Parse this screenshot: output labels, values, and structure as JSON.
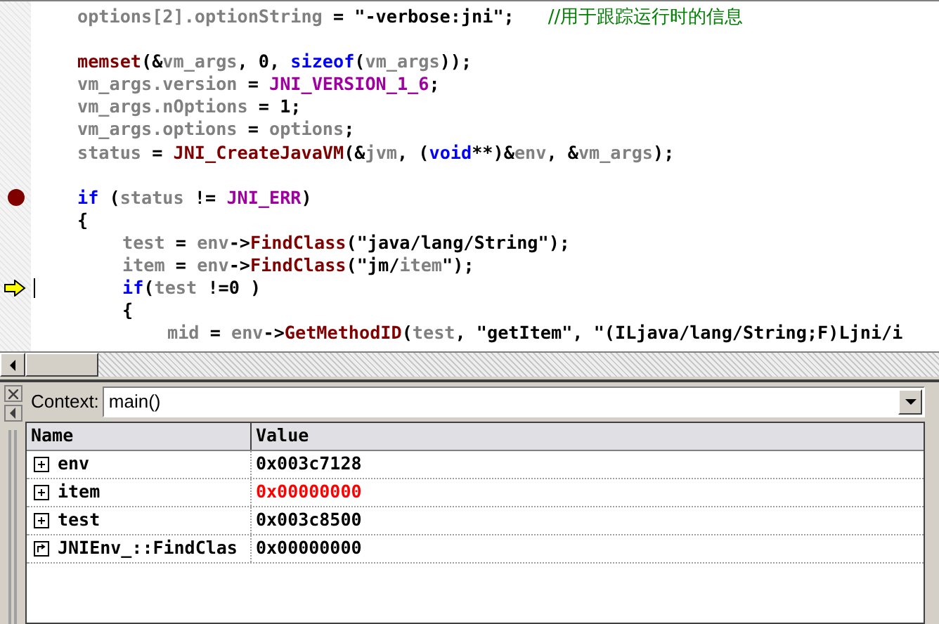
{
  "editor": {
    "lines": [
      {
        "kind": "code",
        "breakpoint": false,
        "current": false,
        "tokens": [
          {
            "kind": "ident",
            "text": "options[2].optionString"
          },
          {
            "kind": "plain",
            "text": " = "
          },
          {
            "kind": "plain",
            "text": "\"-verbose:jni\";"
          },
          {
            "kind": "comment",
            "text": "//用于跟踪运行时的信息"
          }
        ]
      },
      {
        "kind": "blank",
        "breakpoint": false,
        "current": false
      },
      {
        "kind": "code",
        "breakpoint": false,
        "current": false,
        "tokens": [
          {
            "kind": "func",
            "text": "memset"
          },
          {
            "kind": "plain",
            "text": "(&"
          },
          {
            "kind": "ident",
            "text": "vm_args"
          },
          {
            "kind": "plain",
            "text": ", 0, "
          },
          {
            "kind": "keyword",
            "text": "sizeof"
          },
          {
            "kind": "plain",
            "text": "("
          },
          {
            "kind": "ident",
            "text": "vm_args"
          },
          {
            "kind": "plain",
            "text": "));"
          }
        ]
      },
      {
        "kind": "code",
        "breakpoint": false,
        "current": false,
        "tokens": [
          {
            "kind": "ident",
            "text": "vm_args.version"
          },
          {
            "kind": "plain",
            "text": " = "
          },
          {
            "kind": "macro",
            "text": "JNI_VERSION_1_6"
          },
          {
            "kind": "plain",
            "text": ";"
          }
        ]
      },
      {
        "kind": "code",
        "breakpoint": false,
        "current": false,
        "tokens": [
          {
            "kind": "ident",
            "text": "vm_args.nOptions"
          },
          {
            "kind": "plain",
            "text": " = 1;"
          }
        ]
      },
      {
        "kind": "code",
        "breakpoint": false,
        "current": false,
        "tokens": [
          {
            "kind": "ident",
            "text": "vm_args.options"
          },
          {
            "kind": "plain",
            "text": " = "
          },
          {
            "kind": "ident",
            "text": "options"
          },
          {
            "kind": "plain",
            "text": ";"
          }
        ]
      },
      {
        "kind": "code",
        "breakpoint": false,
        "current": false,
        "tokens": [
          {
            "kind": "ident",
            "text": "status"
          },
          {
            "kind": "plain",
            "text": " = "
          },
          {
            "kind": "func",
            "text": "JNI_CreateJavaVM"
          },
          {
            "kind": "plain",
            "text": "(&"
          },
          {
            "kind": "ident",
            "text": "jvm"
          },
          {
            "kind": "plain",
            "text": ", ("
          },
          {
            "kind": "keyword",
            "text": "void"
          },
          {
            "kind": "plain",
            "text": "**)&"
          },
          {
            "kind": "ident",
            "text": "env"
          },
          {
            "kind": "plain",
            "text": ", &"
          },
          {
            "kind": "ident",
            "text": "vm_args"
          },
          {
            "kind": "plain",
            "text": ");"
          }
        ]
      },
      {
        "kind": "blank",
        "breakpoint": false,
        "current": false
      },
      {
        "kind": "code",
        "breakpoint": true,
        "current": false,
        "tokens": [
          {
            "kind": "keyword",
            "text": "if"
          },
          {
            "kind": "plain",
            "text": " ("
          },
          {
            "kind": "ident",
            "text": "status"
          },
          {
            "kind": "plain",
            "text": " != "
          },
          {
            "kind": "macro",
            "text": "JNI_ERR"
          },
          {
            "kind": "plain",
            "text": ")"
          }
        ]
      },
      {
        "kind": "code",
        "breakpoint": false,
        "current": false,
        "tokens": [
          {
            "kind": "plain",
            "text": "{"
          }
        ],
        "children": [
          {
            "kind": "code",
            "breakpoint": false,
            "current": false,
            "tokens": [
              {
                "kind": "ident",
                "text": "test"
              },
              {
                "kind": "plain",
                "text": " = "
              },
              {
                "kind": "ident",
                "text": "env"
              },
              {
                "kind": "plain",
                "text": "->"
              },
              {
                "kind": "func",
                "text": "FindClass"
              },
              {
                "kind": "plain",
                "text": "(\"java/lang/String\");"
              }
            ]
          },
          {
            "kind": "code",
            "breakpoint": false,
            "current": false,
            "tokens": [
              {
                "kind": "ident",
                "text": "item"
              },
              {
                "kind": "plain",
                "text": " = "
              },
              {
                "kind": "ident",
                "text": "env"
              },
              {
                "kind": "plain",
                "text": "->"
              },
              {
                "kind": "func",
                "text": "FindClass"
              },
              {
                "kind": "plain",
                "text": "(\"jm/"
              },
              {
                "kind": "ident",
                "text": "item"
              },
              {
                "kind": "plain",
                "text": "\");"
              }
            ]
          },
          {
            "kind": "code",
            "breakpoint": false,
            "current": true,
            "tokens": [
              {
                "kind": "keyword",
                "text": "if"
              },
              {
                "kind": "plain",
                "text": "("
              },
              {
                "kind": "ident",
                "text": "test"
              },
              {
                "kind": "plain",
                "text": " !=0 )"
              }
            ]
          },
          {
            "kind": "code",
            "breakpoint": false,
            "current": false,
            "tokens": [
              {
                "kind": "plain",
                "text": "{"
              }
            ],
            "children": [
              {
                "kind": "code",
                "breakpoint": false,
                "current": false,
                "tokens": [
                  {
                    "kind": "ident",
                    "text": "mid"
                  },
                  {
                    "kind": "plain",
                    "text": " = "
                  },
                  {
                    "kind": "ident",
                    "text": "env"
                  },
                  {
                    "kind": "plain",
                    "text": "->"
                  },
                  {
                    "kind": "func",
                    "text": "GetMethodID"
                  },
                  {
                    "kind": "plain",
                    "text": "("
                  },
                  {
                    "kind": "ident",
                    "text": "test"
                  },
                  {
                    "kind": "plain",
                    "text": ", \"getItem\", \"(ILjava/lang/String;F)Ljni/i"
                  }
                ]
              }
            ]
          }
        ]
      }
    ]
  },
  "variables": {
    "context_label": "Context:",
    "context_value": "main()",
    "columns": [
      "Name",
      "Value"
    ],
    "rows": [
      {
        "kind": "expandable",
        "name": "env",
        "value": "0x003c7128",
        "changed": false
      },
      {
        "kind": "expandable",
        "name": "item",
        "value": "0x00000000",
        "changed": true
      },
      {
        "kind": "expandable",
        "name": "test",
        "value": "0x003c8500",
        "changed": false
      },
      {
        "kind": "return_value",
        "name": "JNIEnv_::FindClas",
        "value": "0x00000000",
        "changed": false
      }
    ]
  }
}
